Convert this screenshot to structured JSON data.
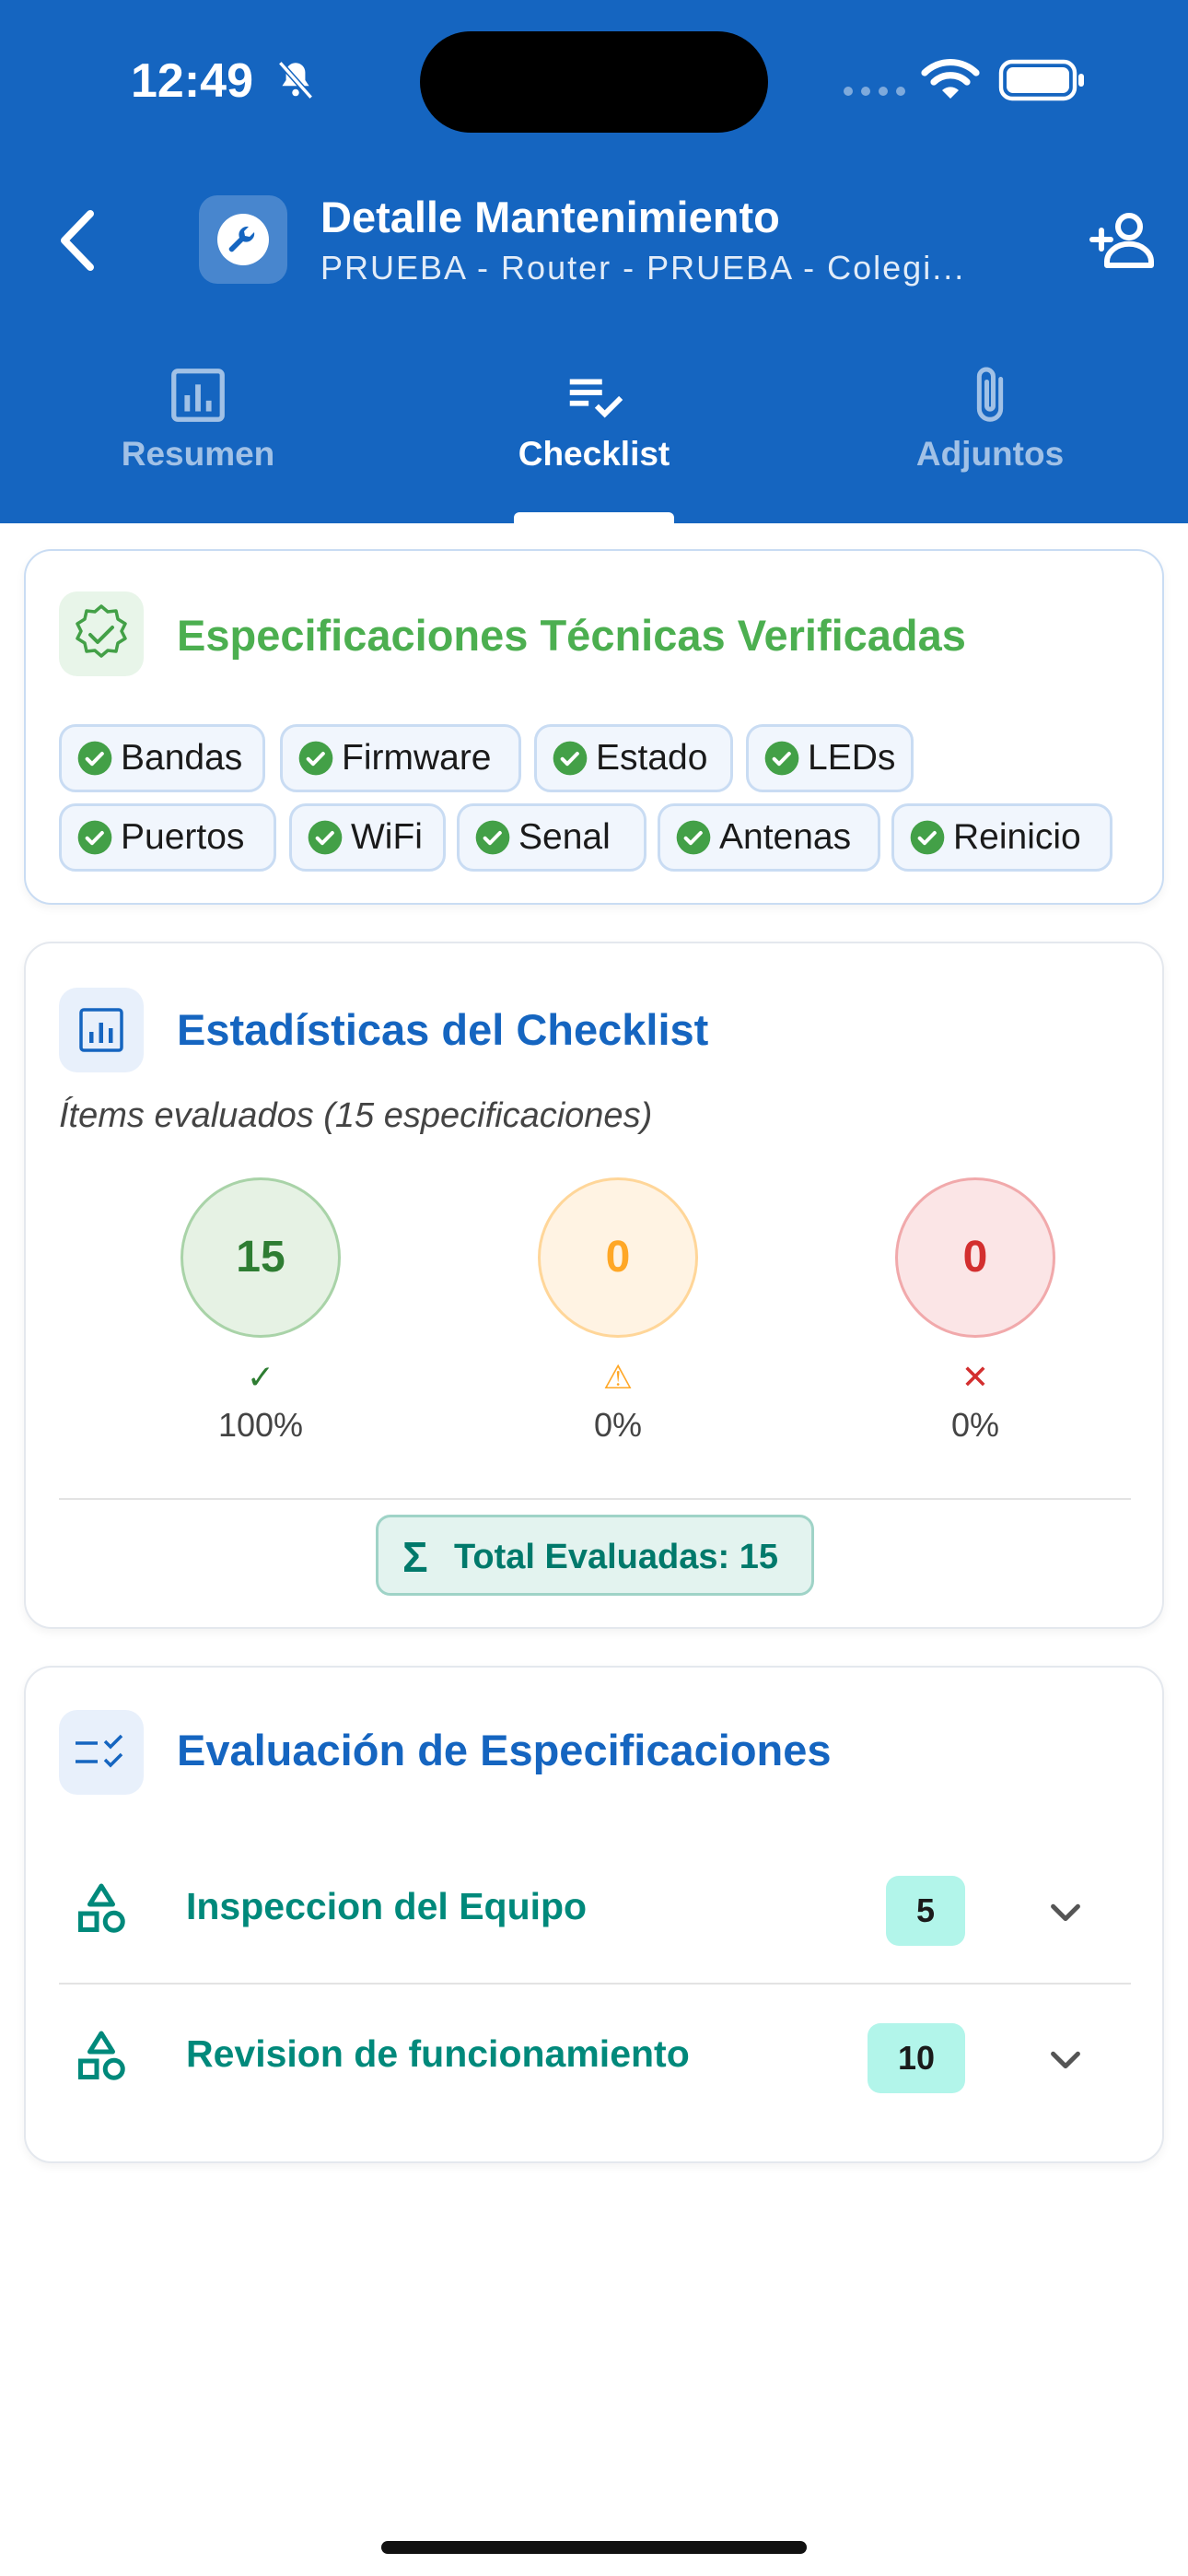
{
  "status_bar": {
    "time": "12:49"
  },
  "header": {
    "title": "Detalle Mantenimiento",
    "subtitle": "PRUEBA - Router - PRUEBA - Colegi..."
  },
  "tabs": [
    {
      "label": "Resumen",
      "icon": "bar-chart-icon",
      "active": false
    },
    {
      "label": "Checklist",
      "icon": "checklist-icon",
      "active": true
    },
    {
      "label": "Adjuntos",
      "icon": "paperclip-icon",
      "active": false
    }
  ],
  "specs_card": {
    "title": "Especificaciones Técnicas Verificadas",
    "chips": [
      "Bandas",
      "Firmware",
      "Estado",
      "LEDs",
      "Puertos",
      "WiFi",
      "Senal",
      "Antenas",
      "Reinicio"
    ]
  },
  "stats_card": {
    "title": "Estadísticas del Checklist",
    "items_evaluated": "Ítems evaluados (15 especificaciones)",
    "stats": [
      {
        "value": "15",
        "symbol": "✓",
        "percent": "100%",
        "status": "ok"
      },
      {
        "value": "0",
        "symbol": "⚠",
        "percent": "0%",
        "status": "warning"
      },
      {
        "value": "0",
        "symbol": "✕",
        "percent": "0%",
        "status": "fail"
      }
    ],
    "total_label": "Total Evaluadas: 15"
  },
  "eval_card": {
    "title": "Evaluación de Especificaciones",
    "sections": [
      {
        "label": "Inspeccion del Equipo",
        "count": "5"
      },
      {
        "label": "Revision de funcionamiento",
        "count": "10"
      }
    ]
  },
  "colors": {
    "primary": "#1565c0",
    "success": "#43a047",
    "warning": "#ffa726",
    "danger": "#d32f2f",
    "teal": "#00897b"
  }
}
